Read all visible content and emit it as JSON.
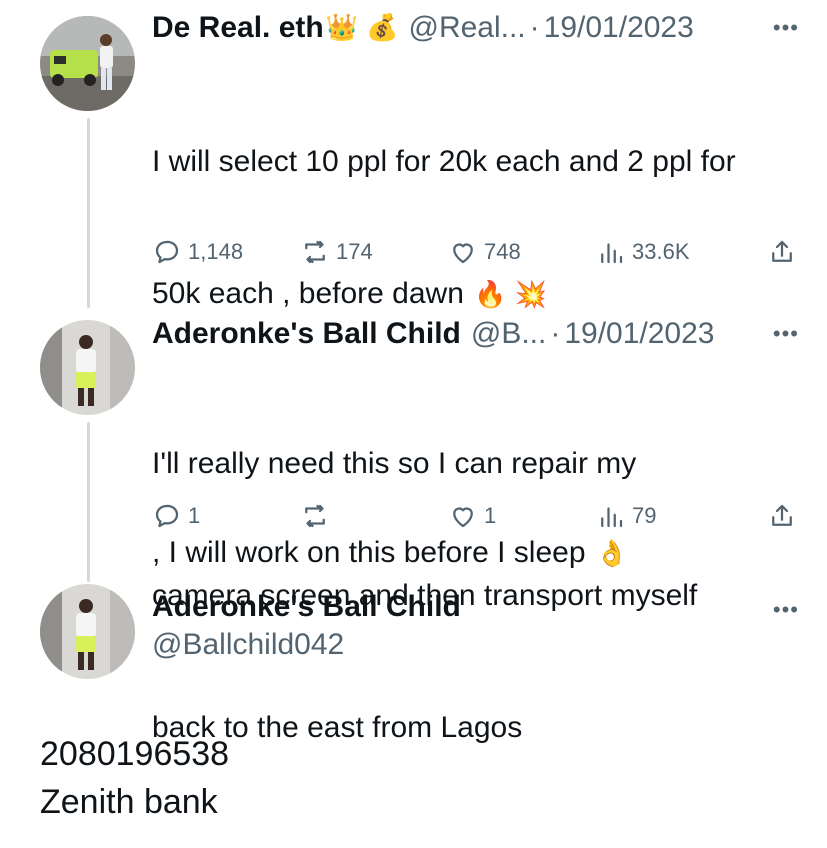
{
  "tweet1": {
    "name": "De Real. eth",
    "emoji_crown": "👑",
    "emoji_bag": "💰",
    "handle": "@Real...",
    "dot": "·",
    "date": "19/01/2023",
    "text_line1": "I will select 10 ppl for 20k each and 2 ppl for",
    "text_line2": "50k each , before dawn",
    "text_line2_emoji": "🔥 💥",
    "text_line3": ", I will work on this before I sleep",
    "text_line3_emoji": "👌",
    "replies": "1,148",
    "retweets": "174",
    "likes": "748",
    "views": "33.6K"
  },
  "tweet2": {
    "name": "Aderonke's Ball Child",
    "handle": "@B...",
    "dot": "·",
    "date": "19/01/2023",
    "text_line1": "I'll really need this so I can repair my",
    "text_line2": "camera screen and then transport myself",
    "text_line3": "back to the east from Lagos",
    "replies": "1",
    "retweets": "",
    "likes": "1",
    "views": "79"
  },
  "profile": {
    "name": "Aderonke's Ball Child",
    "handle": "@Ballchild042"
  },
  "body_text": {
    "line1": "2080196538",
    "line2": "Zenith bank"
  },
  "more_icon": "•••",
  "colors": {
    "text": "#0f1419",
    "secondary": "#536471",
    "thread_line": "#cfd9de"
  }
}
